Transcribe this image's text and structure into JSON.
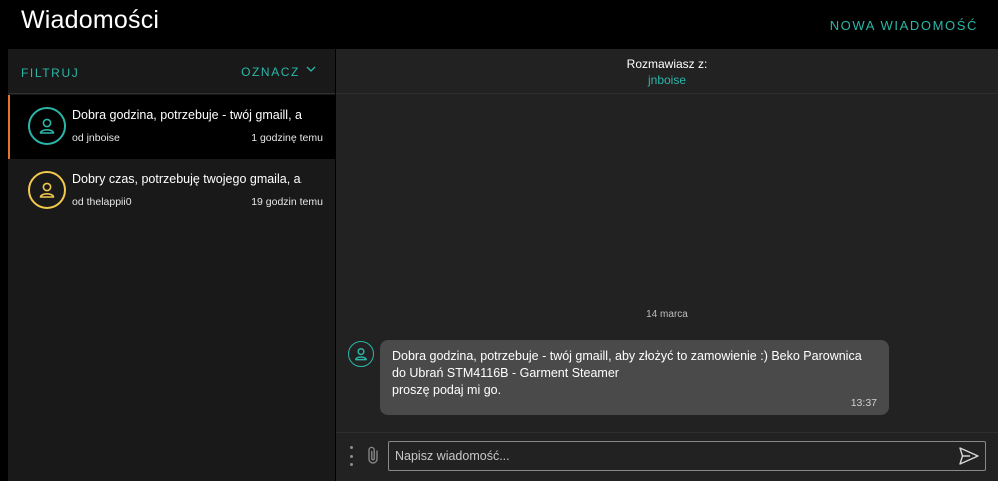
{
  "header": {
    "title": "Wiadomości",
    "new_message_label": "NOWA WIADOMOŚĆ"
  },
  "sidebar": {
    "filter_label": "FILTRUJ",
    "mark_label": "OZNACZ",
    "conversations": [
      {
        "title": "Dobra godzina, potrzebuje - twój gmaill, a...",
        "from": "od jnboise",
        "time": "1 godzinę temu",
        "avatar_color": "#2ab7a9",
        "active": true
      },
      {
        "title": "Dobry czas, potrzebuję twojego gmaila, a...",
        "from": "od thelappii0",
        "time": "19 godzin temu",
        "avatar_color": "#f2c94c",
        "active": false
      }
    ]
  },
  "chat": {
    "with_label": "Rozmawiasz z:",
    "user": "jnboise",
    "date_separator": "14 marca",
    "message": {
      "text": "Dobra godzina, potrzebuje - twój gmaill, aby złożyć to zamowienie :) Beko Parownica do Ubrań STM4116B - Garment Steamer\nproszę podaj mi go.",
      "time": "13:37"
    },
    "composer": {
      "placeholder": "Napisz wiadomość..."
    }
  },
  "colors": {
    "accent": "#2ab7a9",
    "active_marker": "#e8732a",
    "secondary_avatar": "#f2c94c"
  }
}
